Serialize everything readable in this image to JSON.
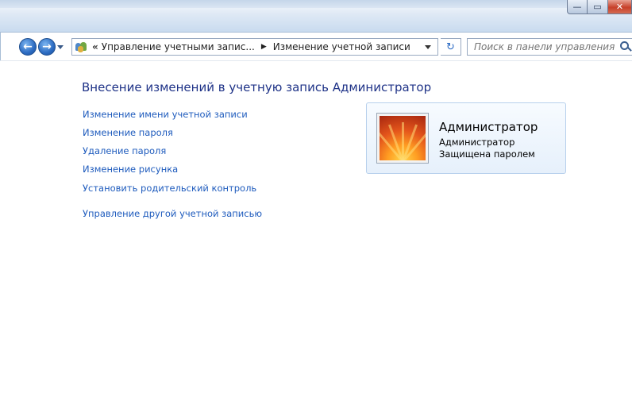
{
  "titlebar": {
    "buttons": {
      "minimize": "—",
      "maximize": "▭",
      "close": "✕"
    }
  },
  "nav": {
    "back_icon": "←",
    "forward_icon": "→",
    "breadcrumb_prefix": "«",
    "breadcrumb": [
      "Управление учетными запис...",
      "Изменение учетной записи"
    ],
    "breadcrumb_separator": "▶",
    "refresh_icon": "↻",
    "search_placeholder": "Поиск в панели управления"
  },
  "main": {
    "title": "Внесение изменений в учетную запись Администратор",
    "links": [
      "Изменение имени учетной записи",
      "Изменение пароля",
      "Удаление пароля",
      "Изменение рисунка",
      "Установить родительский контроль"
    ],
    "other_account_link": "Управление другой учетной записью"
  },
  "user_card": {
    "name": "Администратор",
    "role": "Администратор",
    "status": "Защищена паролем"
  },
  "colors": {
    "link": "#1e5bbd",
    "title": "#1e3287",
    "card_border": "#b7d0ec"
  },
  "icons": {
    "user_accounts": "user-accounts-icon",
    "search": "search-icon",
    "refresh": "refresh-icon",
    "avatar": "flower-avatar"
  }
}
